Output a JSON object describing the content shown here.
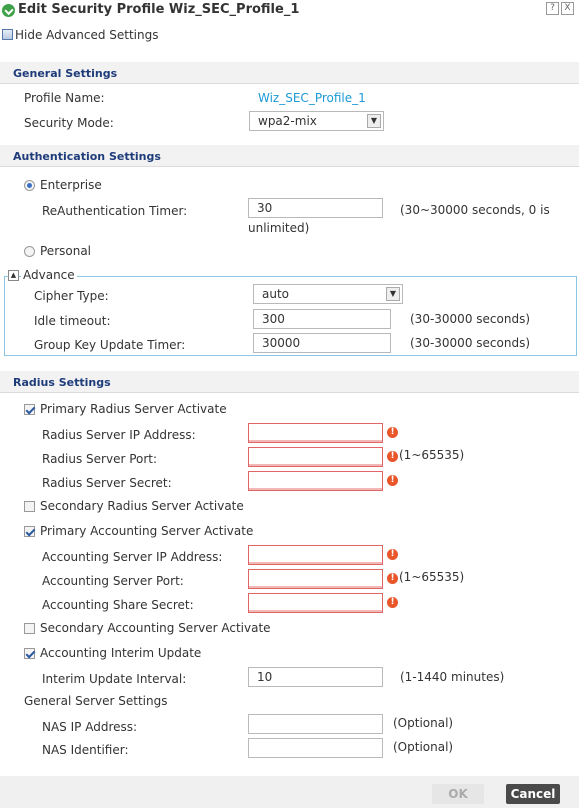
{
  "window": {
    "title": "Edit Security Profile Wiz_SEC_Profile_1",
    "help_label": "?",
    "close_label": "X"
  },
  "toolbar": {
    "hide_advanced": "Hide Advanced Settings"
  },
  "general": {
    "heading": "General Settings",
    "profile_name_label": "Profile Name:",
    "profile_name_value": "Wiz_SEC_Profile_1",
    "security_mode_label": "Security Mode:",
    "security_mode_value": "wpa2-mix"
  },
  "auth": {
    "heading": "Authentication Settings",
    "enterprise_label": "Enterprise",
    "reauth_label": "ReAuthentication Timer:",
    "reauth_value": "30",
    "reauth_hint_1": "(30~30000 seconds, 0 is",
    "reauth_hint_2": "unlimited)",
    "personal_label": "Personal",
    "advance_label": "Advance",
    "cipher_label": "Cipher Type:",
    "cipher_value": "auto",
    "idle_label": "Idle timeout:",
    "idle_value": "300",
    "idle_hint": "(30-30000 seconds)",
    "gku_label": "Group Key Update Timer:",
    "gku_value": "30000",
    "gku_hint": "(30-30000 seconds)"
  },
  "radius": {
    "heading": "Radius Settings",
    "primary_radius_label": "Primary Radius Server Activate",
    "rs_ip_label": "Radius Server IP Address:",
    "rs_ip_value": "",
    "rs_port_label": "Radius Server Port:",
    "rs_port_value": "",
    "rs_port_hint": "(1~65535)",
    "rs_secret_label": "Radius Server Secret:",
    "rs_secret_value": "",
    "secondary_radius_label": "Secondary Radius Server Activate",
    "primary_acct_label": "Primary Accounting Server Activate",
    "as_ip_label": "Accounting Server IP Address:",
    "as_ip_value": "",
    "as_port_label": "Accounting Server Port:",
    "as_port_value": "",
    "as_port_hint": "(1~65535)",
    "as_secret_label": "Accounting Share Secret:",
    "as_secret_value": "",
    "secondary_acct_label": "Secondary Accounting Server Activate",
    "interim_label": "Accounting Interim Update",
    "interim_interval_label": "Interim Update Interval:",
    "interim_interval_value": "10",
    "interim_hint": "(1-1440 minutes)",
    "general_server_label": "General Server Settings",
    "nas_ip_label": "NAS IP Address:",
    "nas_ip_value": "",
    "nas_ip_hint": "(Optional)",
    "nas_id_label": "NAS Identifier:",
    "nas_id_value": "",
    "nas_id_hint": "(Optional)"
  },
  "footer": {
    "ok_label": "OK",
    "cancel_label": "Cancel"
  },
  "colors": {
    "accent": "#1e9ad6",
    "heading": "#1f3c7a",
    "error": "#e8562a"
  }
}
